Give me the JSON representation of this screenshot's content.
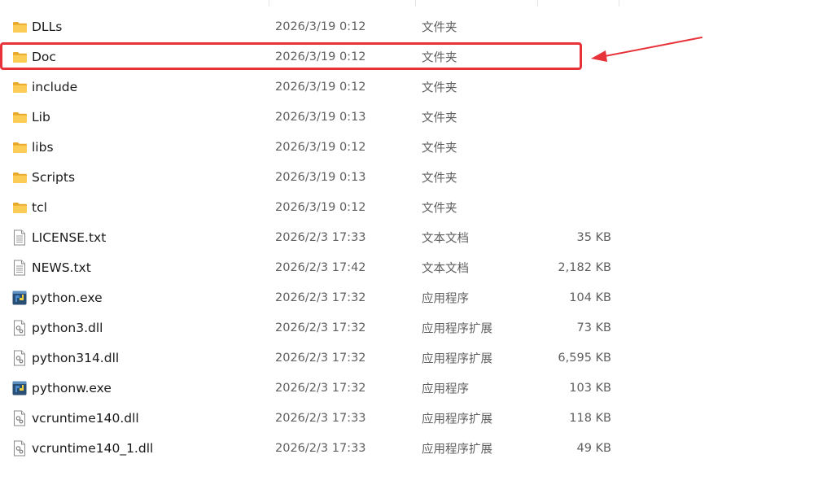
{
  "files": [
    {
      "name": "DLLs",
      "date": "2026/3/19 0:12",
      "type": "文件夹",
      "size": "",
      "icon": "folder-icon"
    },
    {
      "name": "Doc",
      "date": "2026/3/19 0:12",
      "type": "文件夹",
      "size": "",
      "icon": "folder-icon"
    },
    {
      "name": "include",
      "date": "2026/3/19 0:12",
      "type": "文件夹",
      "size": "",
      "icon": "folder-icon"
    },
    {
      "name": "Lib",
      "date": "2026/3/19 0:13",
      "type": "文件夹",
      "size": "",
      "icon": "folder-icon"
    },
    {
      "name": "libs",
      "date": "2026/3/19 0:12",
      "type": "文件夹",
      "size": "",
      "icon": "folder-icon"
    },
    {
      "name": "Scripts",
      "date": "2026/3/19 0:13",
      "type": "文件夹",
      "size": "",
      "icon": "folder-icon"
    },
    {
      "name": "tcl",
      "date": "2026/3/19 0:12",
      "type": "文件夹",
      "size": "",
      "icon": "folder-icon"
    },
    {
      "name": "LICENSE.txt",
      "date": "2026/2/3 17:33",
      "type": "文本文档",
      "size": "35 KB",
      "icon": "text-file-icon"
    },
    {
      "name": "NEWS.txt",
      "date": "2026/2/3 17:42",
      "type": "文本文档",
      "size": "2,182 KB",
      "icon": "text-file-icon"
    },
    {
      "name": "python.exe",
      "date": "2026/2/3 17:32",
      "type": "应用程序",
      "size": "104 KB",
      "icon": "python-exe-icon"
    },
    {
      "name": "python3.dll",
      "date": "2026/2/3 17:32",
      "type": "应用程序扩展",
      "size": "73 KB",
      "icon": "dll-file-icon"
    },
    {
      "name": "python314.dll",
      "date": "2026/2/3 17:32",
      "type": "应用程序扩展",
      "size": "6,595 KB",
      "icon": "dll-file-icon"
    },
    {
      "name": "pythonw.exe",
      "date": "2026/2/3 17:32",
      "type": "应用程序",
      "size": "103 KB",
      "icon": "python-exe-icon"
    },
    {
      "name": "vcruntime140.dll",
      "date": "2026/2/3 17:33",
      "type": "应用程序扩展",
      "size": "118 KB",
      "icon": "dll-file-icon"
    },
    {
      "name": "vcruntime140_1.dll",
      "date": "2026/2/3 17:33",
      "type": "应用程序扩展",
      "size": "49 KB",
      "icon": "dll-file-icon"
    }
  ],
  "annotation": {
    "highlighted_item": "Doc",
    "color": "#e8323a"
  },
  "colors": {
    "folder": "#f8c94a",
    "secondary_text": "#5f5f5f"
  }
}
